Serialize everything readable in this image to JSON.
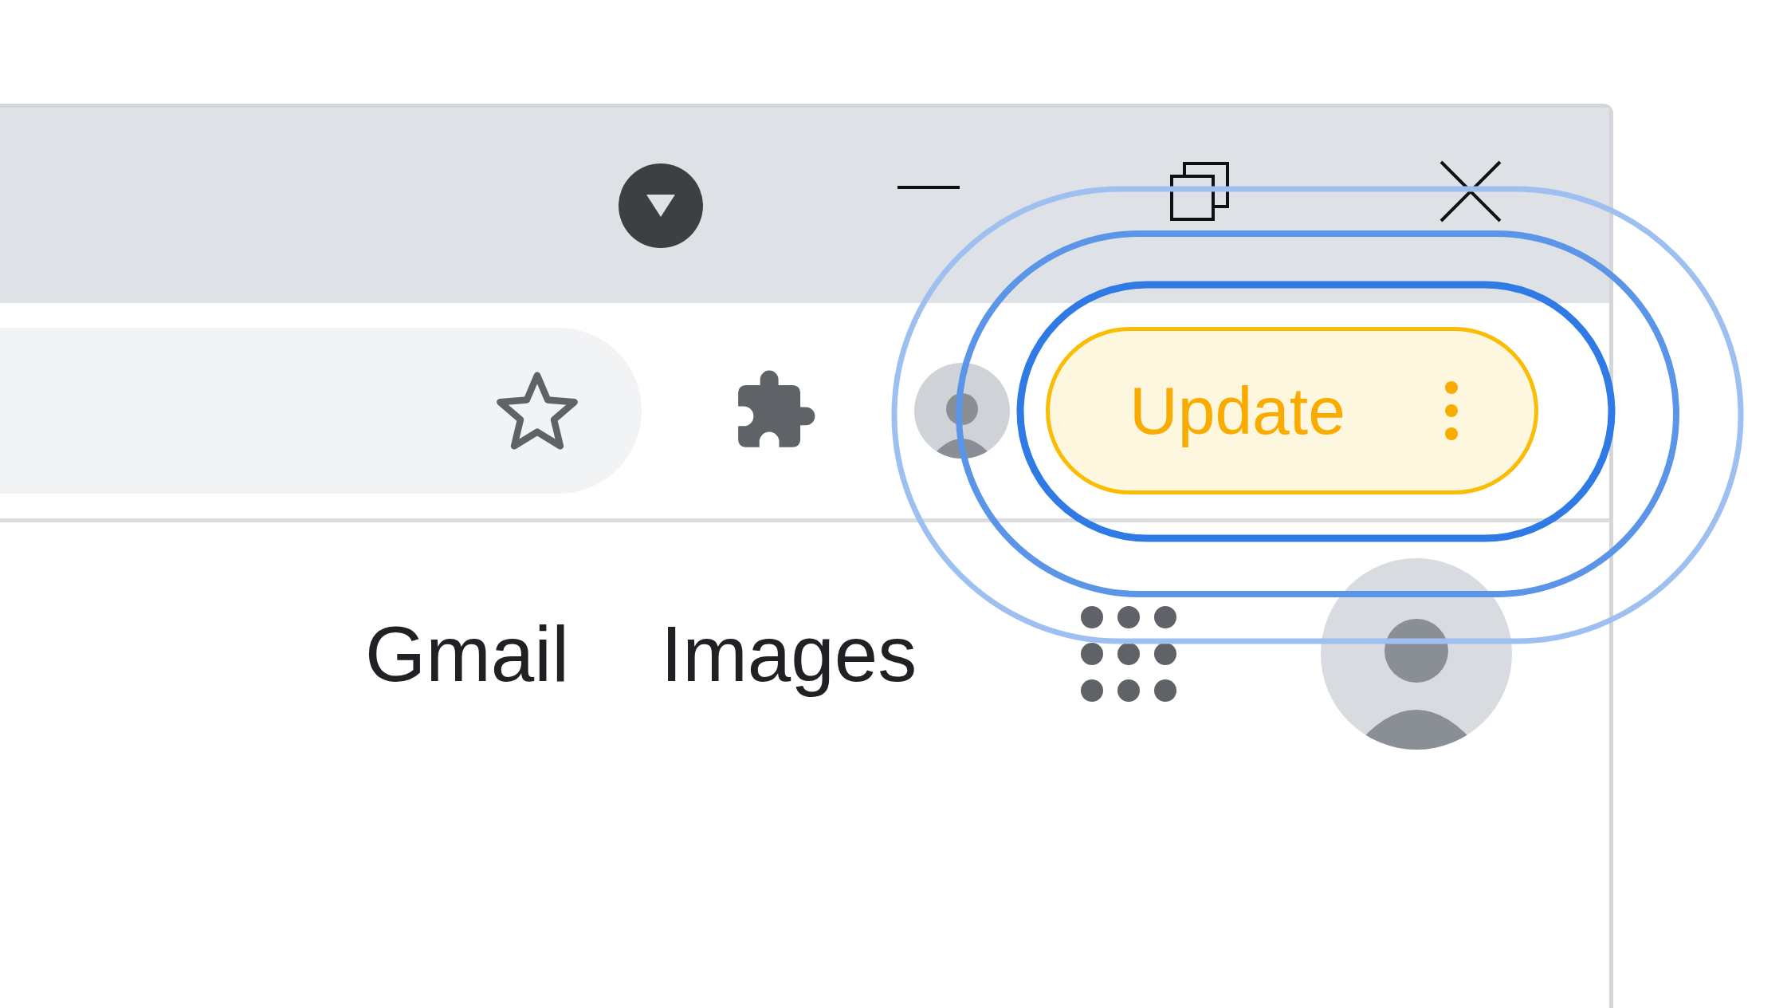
{
  "toolbar": {
    "update_button": {
      "label": "Update"
    }
  },
  "content": {
    "links": [
      {
        "label": "Gmail"
      },
      {
        "label": "Images"
      }
    ]
  }
}
